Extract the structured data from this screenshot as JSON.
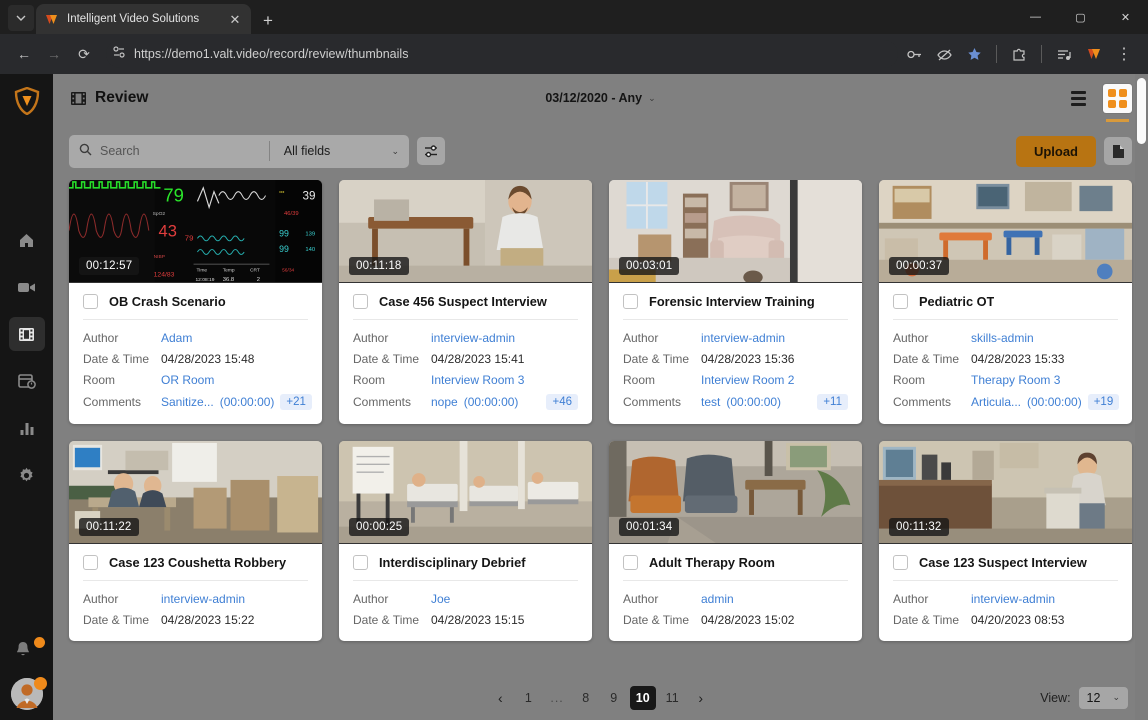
{
  "browser": {
    "tab_title": "Intelligent Video Solutions",
    "new_tab_label": "+",
    "close_tab_label": "✕",
    "url": "https://demo1.valt.video/record/review/thumbnails",
    "back_label": "←",
    "forward_label": "→",
    "reload_label": "⟳",
    "minimize_label": "—",
    "maximize_label": "▢",
    "close_label": "✕",
    "menu_label": "⋮",
    "icons": [
      "password-key-icon",
      "eye-off-icon",
      "bookmark-star-icon",
      "extensions-icon",
      "media-control-icon",
      "profile-icon",
      "browser-menu-icon"
    ]
  },
  "sidebar": {
    "logo": "valt-shield-logo",
    "items": [
      {
        "name": "home",
        "icon": "home-icon"
      },
      {
        "name": "record",
        "icon": "video-camera-icon"
      },
      {
        "name": "review",
        "icon": "film-strip-icon",
        "active": true
      },
      {
        "name": "schedule",
        "icon": "calendar-clock-icon"
      },
      {
        "name": "reports",
        "icon": "bar-chart-icon"
      },
      {
        "name": "settings",
        "icon": "gear-icon"
      }
    ],
    "bottom": [
      {
        "name": "notifications",
        "icon": "bell-icon",
        "badge": true
      },
      {
        "name": "account",
        "icon": "avatar-icon",
        "badge": true
      }
    ]
  },
  "header": {
    "title": "Review",
    "title_icon": "film-strip-icon",
    "date_filter": "03/12/2020 - Any",
    "date_caret": "⌄",
    "view_list_label": "list-view",
    "view_grid_label": "grid-view",
    "active_view": "grid"
  },
  "toolbar": {
    "search_placeholder": "Search",
    "search_value": "",
    "field_selector": "All fields",
    "field_caret": "⌄",
    "filter_icon": "filter-sliders-icon",
    "upload_label": "Upload",
    "document_icon": "document-icon"
  },
  "cards": [
    {
      "duration": "00:12:57",
      "title": "OB Crash Scenario",
      "author_label": "Author",
      "author": "Adam",
      "datetime_label": "Date & Time",
      "datetime": "04/28/2023 15:48",
      "room_label": "Room",
      "room": "OR Room",
      "comments_label": "Comments",
      "comment_text": "Sanitize...",
      "comment_time": "(00:00:00)",
      "comment_more": "+21",
      "thumb": "vitals-monitor"
    },
    {
      "duration": "00:11:18",
      "title": "Case 456 Suspect Interview",
      "author_label": "Author",
      "author": "interview-admin",
      "datetime_label": "Date & Time",
      "datetime": "04/28/2023 15:41",
      "room_label": "Room",
      "room": "Interview Room 3",
      "comments_label": "Comments",
      "comment_text": "nope",
      "comment_time": "(00:00:00)",
      "comment_more": "+46",
      "thumb": "interview-room-man"
    },
    {
      "duration": "00:03:01",
      "title": "Forensic Interview Training",
      "author_label": "Author",
      "author": "interview-admin",
      "datetime_label": "Date & Time",
      "datetime": "04/28/2023 15:36",
      "room_label": "Room",
      "room": "Interview Room 2",
      "comments_label": "Comments",
      "comment_text": "test",
      "comment_time": "(00:00:00)",
      "comment_more": "+11",
      "thumb": "forensic-room-couch"
    },
    {
      "duration": "00:00:37",
      "title": "Pediatric OT",
      "author_label": "Author",
      "author": "skills-admin",
      "datetime_label": "Date & Time",
      "datetime": "04/28/2023 15:33",
      "room_label": "Room",
      "room": "Therapy Room 3",
      "comments_label": "Comments",
      "comment_text": "Articula...",
      "comment_time": "(00:00:00)",
      "comment_more": "+19",
      "thumb": "pediatric-therapy-room"
    },
    {
      "duration": "00:11:22",
      "title": "Case 123 Coushetta Robbery",
      "author_label": "Author",
      "author": "interview-admin",
      "datetime_label": "Date & Time",
      "datetime": "04/28/2023 15:22",
      "thumb": "office-desk-room"
    },
    {
      "duration": "00:00:25",
      "title": "Interdisciplinary Debrief",
      "author_label": "Author",
      "author": "Joe",
      "datetime_label": "Date & Time",
      "datetime": "04/28/2023 15:15",
      "thumb": "simulation-ward"
    },
    {
      "duration": "00:01:34",
      "title": "Adult Therapy Room",
      "author_label": "Author",
      "author": "admin",
      "datetime_label": "Date & Time",
      "datetime": "04/28/2023 15:02",
      "thumb": "waiting-area-chairs"
    },
    {
      "duration": "00:11:32",
      "title": "Case 123 Suspect Interview",
      "author_label": "Author",
      "author": "interview-admin",
      "datetime_label": "Date & Time",
      "datetime": "04/20/2023 08:53",
      "thumb": "interview-room-seated"
    }
  ],
  "footer": {
    "prev_label": "‹",
    "next_label": "›",
    "pages": [
      "1",
      "...",
      "8",
      "9",
      "10",
      "11"
    ],
    "current_page": "10",
    "view_label": "View:",
    "view_count": "12",
    "view_caret": "⌄"
  },
  "colors": {
    "accent_orange": "#ef8f1c",
    "upload_button": "#b87412",
    "link_blue": "#3f7fd4",
    "content_bg": "#808080",
    "sidebar_bg": "#151515"
  }
}
